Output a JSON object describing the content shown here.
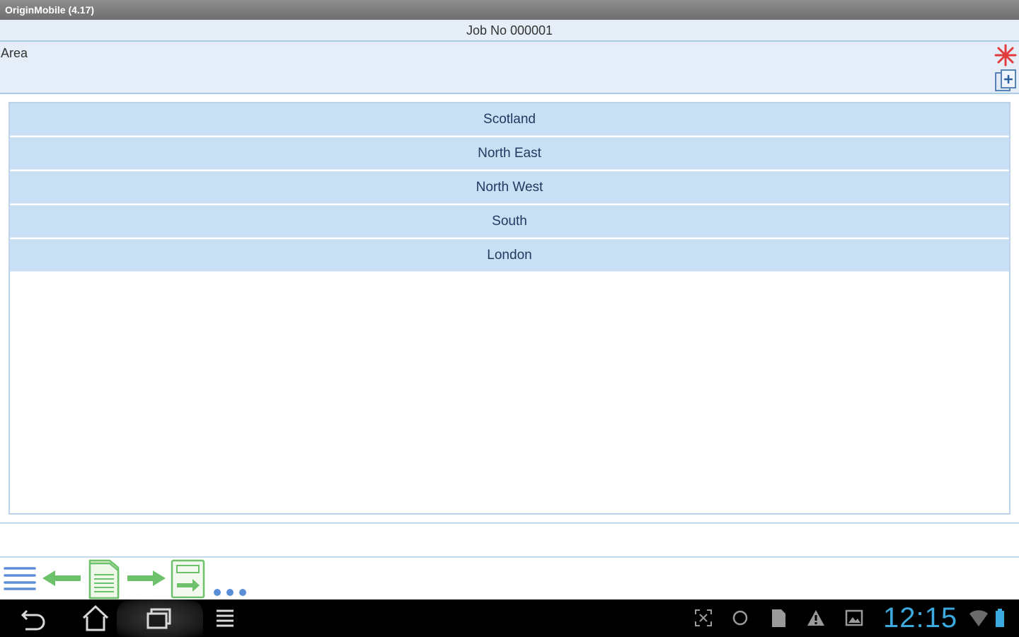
{
  "window": {
    "title": "OriginMobile (4.17)"
  },
  "job": {
    "title": "Job No 000001"
  },
  "area": {
    "label": "Area"
  },
  "list": {
    "items": [
      {
        "label": "Scotland"
      },
      {
        "label": "North East"
      },
      {
        "label": "North West"
      },
      {
        "label": "South"
      },
      {
        "label": "London"
      }
    ]
  },
  "status": {
    "time": "12:15"
  },
  "colors": {
    "accent": "#c9dff3",
    "item_text": "#1f3b61",
    "star": "#e23b3b",
    "arrow": "#6cc16a",
    "clock": "#3ca9df"
  },
  "icons": {
    "toolbar": [
      "menu-icon",
      "back-arrow-icon",
      "document-list-icon",
      "forward-arrow-icon",
      "form-next-icon",
      "more-icon"
    ],
    "header": [
      "required-star-icon",
      "add-document-icon"
    ],
    "navbar": [
      "back-icon",
      "home-icon",
      "recent-apps-icon",
      "menu-icon",
      "screenshot-icon",
      "sync-icon",
      "sd-card-icon",
      "warning-icon",
      "gallery-icon",
      "wifi-icon",
      "battery-icon"
    ]
  }
}
